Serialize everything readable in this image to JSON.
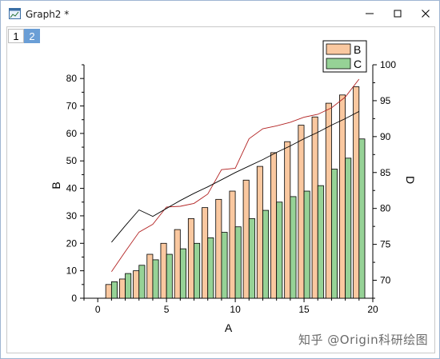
{
  "window": {
    "title": "Graph2 *",
    "icons": {
      "app": "graph-window-icon",
      "minimize": "minimize-icon",
      "maximize": "maximize-icon",
      "close": "close-icon"
    }
  },
  "layers": [
    {
      "label": "1",
      "active": false
    },
    {
      "label": "2",
      "active": true
    }
  ],
  "watermark": "知乎 @Origin科研绘图",
  "colors": {
    "bar_b": "#fac8a0",
    "bar_c": "#96d296",
    "line_red": "#b22222",
    "line_black": "#000000",
    "tab_active": "#6a9ed6"
  },
  "chart_data": {
    "type": "bar",
    "xlabel": "A",
    "ylabel": "B",
    "y2label": "D",
    "xlim": [
      -1,
      20
    ],
    "ylim": [
      0,
      85
    ],
    "y2lim": [
      67.5,
      100
    ],
    "xticks": [
      0,
      5,
      10,
      15,
      20
    ],
    "yticks": [
      0,
      10,
      20,
      30,
      40,
      50,
      60,
      70,
      80
    ],
    "y2ticks": [
      70,
      75,
      80,
      85,
      90,
      95,
      100
    ],
    "x": [
      1,
      2,
      3,
      4,
      5,
      6,
      7,
      8,
      9,
      10,
      11,
      12,
      13,
      14,
      15,
      16,
      17,
      18,
      19
    ],
    "legend": {
      "placement": "top-right",
      "entries": [
        "B",
        "C"
      ]
    },
    "series": [
      {
        "name": "B",
        "kind": "bar",
        "color": "#fac8a0",
        "values": [
          5,
          7,
          10,
          16,
          20,
          25,
          29,
          33,
          36,
          39,
          43,
          48,
          53,
          57,
          63,
          66,
          71,
          74,
          77
        ]
      },
      {
        "name": "C",
        "kind": "bar",
        "color": "#96d296",
        "values": [
          6,
          9,
          12,
          14,
          16,
          18,
          20,
          22,
          24,
          26,
          29,
          32,
          35,
          37,
          39,
          41,
          47,
          51,
          58
        ]
      },
      {
        "kind": "line",
        "axis": "right",
        "color": "#b22222",
        "values": [
          71.2,
          74.0,
          76.7,
          77.8,
          80.2,
          80.3,
          80.7,
          82.0,
          85.4,
          85.6,
          89.7,
          91.1,
          91.5,
          92.0,
          92.7,
          93.1,
          94.0,
          95.5,
          98.0
        ]
      },
      {
        "kind": "line",
        "axis": "right",
        "color": "#000000",
        "values": [
          75.3,
          77.6,
          79.8,
          78.9,
          80.0,
          81.1,
          82.1,
          83.0,
          84.0,
          85.0,
          85.9,
          86.8,
          87.8,
          88.7,
          89.7,
          90.6,
          91.6,
          92.5,
          93.5
        ]
      }
    ]
  }
}
